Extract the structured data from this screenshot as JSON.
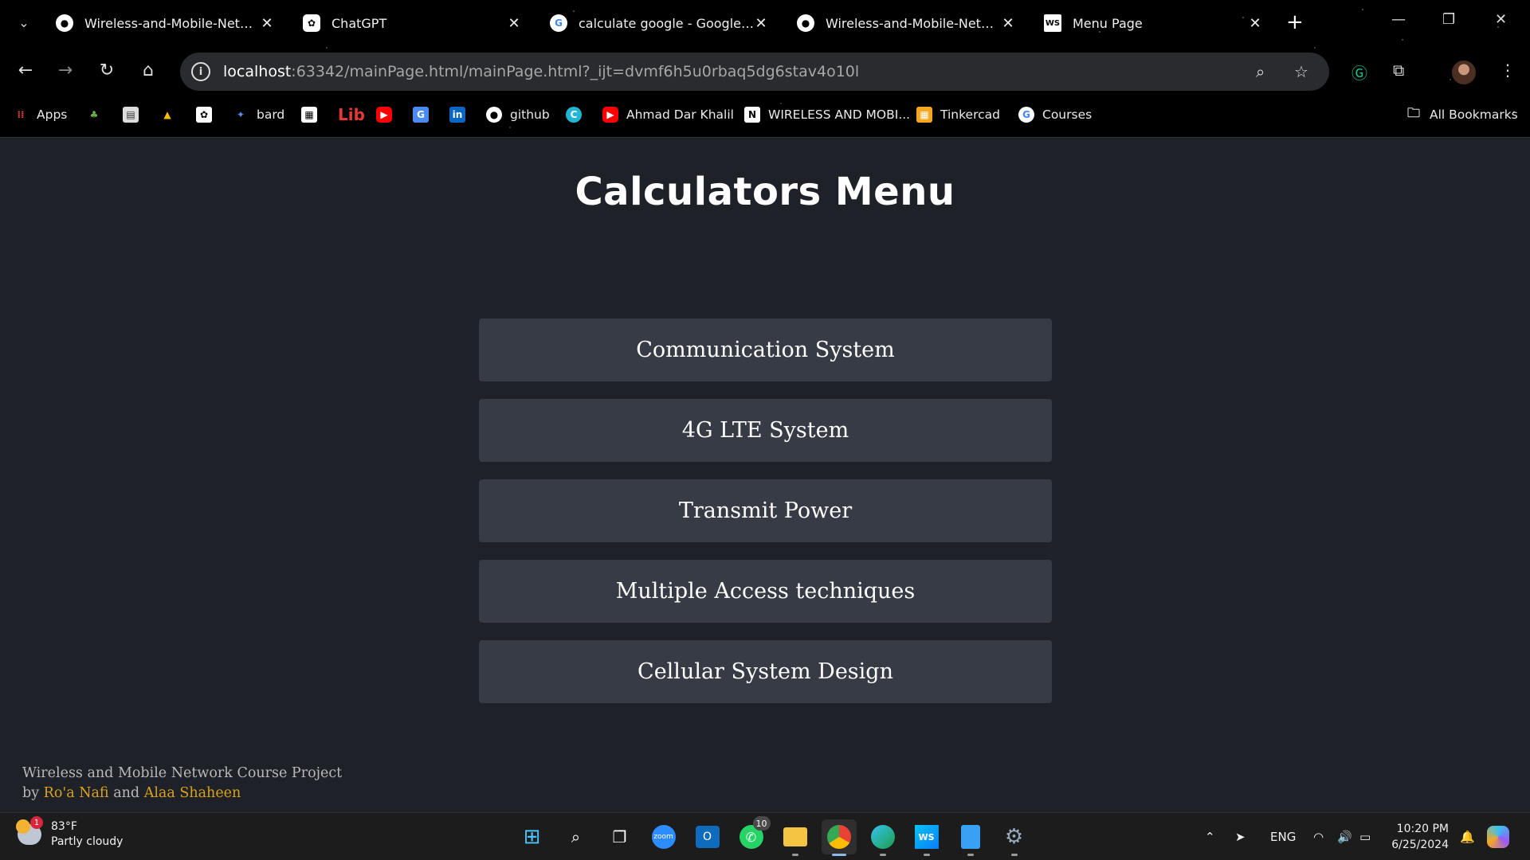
{
  "browser": {
    "tabs": [
      {
        "title": "Wireless-and-Mobile-Network",
        "favicon": "github-icon",
        "active": false
      },
      {
        "title": "ChatGPT",
        "favicon": "chatgpt-icon",
        "active": false
      },
      {
        "title": "calculate google - Google Search",
        "favicon": "google-icon",
        "active": false
      },
      {
        "title": "Wireless-and-Mobile-Network",
        "favicon": "github-icon",
        "active": false
      },
      {
        "title": "Menu Page",
        "favicon": "webstorm-icon",
        "active": true
      }
    ],
    "url_host": "localhost",
    "url_rest": ":63342/mainPage.html/mainPage.html?_ijt=dvmf6h5u0rbaq5dg6stav4o10l",
    "bookmarks": {
      "apps": "Apps",
      "bard": "bard",
      "lib": "Lib",
      "github": "github",
      "ahmad": "Ahmad Dar Khalil",
      "wireless": "WIRELESS AND MOBI...",
      "tinkercad": "Tinkercad",
      "courses": "Courses",
      "all": "All Bookmarks"
    }
  },
  "page": {
    "title": "Calculators Menu",
    "menu": [
      "Communication System",
      "4G LTE System",
      "Transmit Power",
      "Multiple Access techniques",
      "Cellular System Design"
    ],
    "footer": {
      "line1": "Wireless and Mobile Network Course Project",
      "by": "by",
      "author1": "Ro'a Nafi",
      "and": "and",
      "author2": "Alaa Shaheen"
    },
    "colors": {
      "background": "#1f2128",
      "button": "#373b45",
      "author": "#d9a21b"
    }
  },
  "taskbar": {
    "weather_temp": "83°F",
    "weather_desc": "Partly cloudy",
    "weather_badge": "1",
    "whatsapp_badge": "10",
    "language": "ENG",
    "time": "10:20 PM",
    "date": "6/25/2024"
  }
}
